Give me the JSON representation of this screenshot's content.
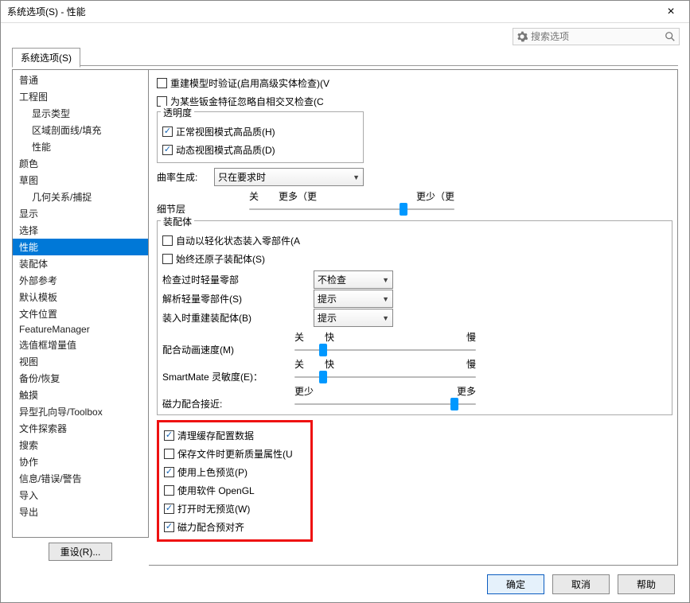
{
  "window": {
    "title": "系统选项(S) - 性能"
  },
  "search": {
    "placeholder": "搜索选项"
  },
  "tab": {
    "label": "系统选项(S)"
  },
  "nav": {
    "items": [
      {
        "label": "普通",
        "sub": false
      },
      {
        "label": "工程图",
        "sub": false
      },
      {
        "label": "显示类型",
        "sub": true
      },
      {
        "label": "区域剖面线/填充",
        "sub": true
      },
      {
        "label": "性能",
        "sub": true
      },
      {
        "label": "颜色",
        "sub": false
      },
      {
        "label": "草图",
        "sub": false
      },
      {
        "label": "几何关系/捕捉",
        "sub": true
      },
      {
        "label": "显示",
        "sub": false
      },
      {
        "label": "选择",
        "sub": false
      },
      {
        "label": "性能",
        "sub": false,
        "selected": true
      },
      {
        "label": "装配体",
        "sub": false
      },
      {
        "label": "外部参考",
        "sub": false
      },
      {
        "label": "默认模板",
        "sub": false
      },
      {
        "label": "文件位置",
        "sub": false
      },
      {
        "label": "FeatureManager",
        "sub": false
      },
      {
        "label": "选值框增量值",
        "sub": false
      },
      {
        "label": "视图",
        "sub": false
      },
      {
        "label": "备份/恢复",
        "sub": false
      },
      {
        "label": "触摸",
        "sub": false
      },
      {
        "label": "异型孔向导/Toolbox",
        "sub": false
      },
      {
        "label": "文件探索器",
        "sub": false
      },
      {
        "label": "搜索",
        "sub": false
      },
      {
        "label": "协作",
        "sub": false
      },
      {
        "label": "信息/错误/警告",
        "sub": false
      },
      {
        "label": "导入",
        "sub": false
      },
      {
        "label": "导出",
        "sub": false
      }
    ],
    "reset": "重设(R)..."
  },
  "c": {
    "verifyRebuild": "重建模型时验证(启用高级实体检查)(V",
    "ignoreSelf": "为某些钣金特征忽略自相交叉检查(C",
    "transparency": {
      "title": "透明度",
      "normal": "正常视图模式高品质(H)",
      "dynamic": "动态视图模式高品质(D)"
    },
    "curvature": {
      "label": "曲率生成:",
      "value": "只在要求时"
    },
    "detail": {
      "label": "细节层",
      "left": "关",
      "mid": "更多（更",
      "right": "更少（更",
      "pos": 75
    },
    "asm": {
      "title": "装配体",
      "lightLoad": "自动以轻化状态装入零部件(A",
      "alwaysResolve": "始终还原子装配体(S)",
      "r1l": "检查过时轻量零部",
      "r1v": "不检查",
      "r2l": "解析轻量零部件(S)",
      "r2v": "提示",
      "r3l": "装入时重建装配体(B)",
      "r3v": "提示",
      "s1": {
        "label": "配合动画速度(M)",
        "left": "关",
        "mid": "快",
        "right": "慢",
        "pos": 16
      },
      "s2": {
        "label": "SmartMate 灵敏度(E)：",
        "left": "关",
        "mid": "快",
        "right": "慢",
        "pos": 16
      },
      "s3": {
        "label": "磁力配合接近:",
        "left": "更少",
        "right": "更多",
        "pos": 88
      }
    },
    "box": {
      "b1": "清理缓存配置数据",
      "b2": "保存文件时更新质量属性(U",
      "b3": "使用上色预览(P)",
      "b4": "使用软件 OpenGL",
      "b5": "打开时无预览(W)",
      "b6": "磁力配合预对齐"
    }
  },
  "footer": {
    "ok": "确定",
    "cancel": "取消",
    "help": "帮助"
  }
}
